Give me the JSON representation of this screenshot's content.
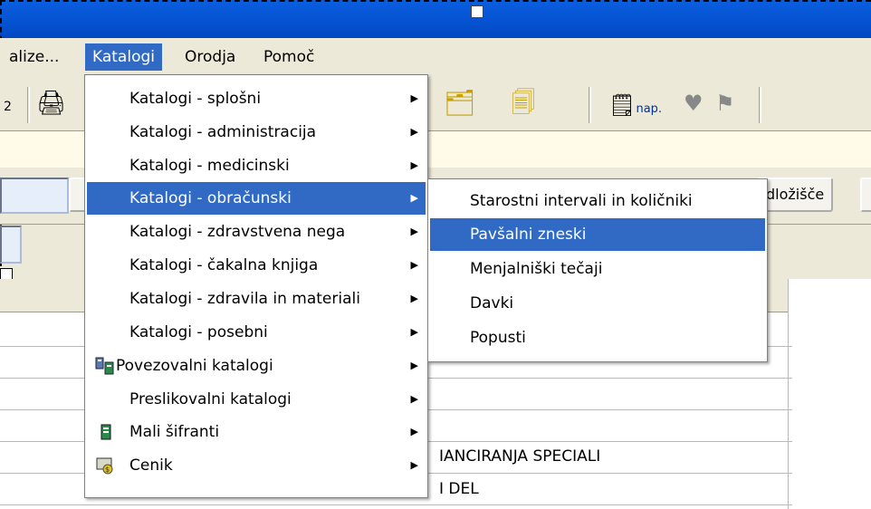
{
  "menubar": {
    "items": [
      {
        "label": "alize..."
      },
      {
        "label": "Katalogi"
      },
      {
        "label": "Orodja"
      },
      {
        "label": "Pomoč"
      }
    ]
  },
  "toolbar": {
    "nap_label": "nap."
  },
  "band": {
    "button_label": "dložišče"
  },
  "table": {
    "row1": "IANCIRANJA SPECIALI",
    "row2": "I  DEL"
  },
  "katalogi_menu": {
    "items": [
      {
        "label": "Katalogi - splošni"
      },
      {
        "label": "Katalogi - administracija"
      },
      {
        "label": "Katalogi - medicinski"
      },
      {
        "label": "Katalogi - obračunski"
      },
      {
        "label": "Katalogi - zdravstvena nega"
      },
      {
        "label": "Katalogi - čakalna knjiga"
      },
      {
        "label": "Katalogi - zdravila in materiali"
      },
      {
        "label": "Katalogi - posebni"
      },
      {
        "label": "Povezovalni katalogi"
      },
      {
        "label": "Preslikovalni katalogi"
      },
      {
        "label": "Mali šifranti"
      },
      {
        "label": "Cenik"
      }
    ]
  },
  "obracunski_submenu": {
    "items": [
      {
        "label": "Starostni intervali in količniki"
      },
      {
        "label": "Pavšalni zneski"
      },
      {
        "label": "Menjalniški tečaji"
      },
      {
        "label": "Davki"
      },
      {
        "label": "Popusti"
      }
    ]
  },
  "colors": {
    "highlight": "#316ac5",
    "titlebar": "#0552d0"
  }
}
